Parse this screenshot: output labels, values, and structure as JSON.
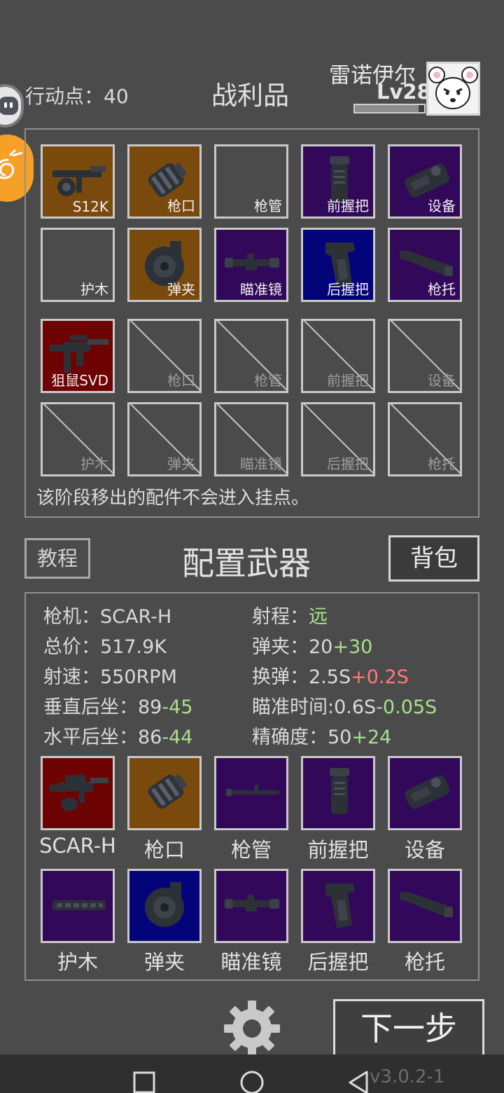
{
  "header": {
    "action_points": "行动点：40",
    "title": "战利品",
    "player_name": "雷诺伊尔",
    "player_level": "Lv28",
    "xp_progress": 0.92
  },
  "loot": {
    "rows": [
      [
        {
          "label": "S12K",
          "quality": "orange",
          "icon": "shotgun-icon"
        },
        {
          "label": "枪口",
          "quality": "orange",
          "icon": "muzzle-icon"
        },
        {
          "label": "枪管",
          "quality": "empty",
          "icon": ""
        },
        {
          "label": "前握把",
          "quality": "purple",
          "icon": "foregrip-icon"
        },
        {
          "label": "设备",
          "quality": "purple",
          "icon": "device-icon"
        }
      ],
      [
        {
          "label": "护木",
          "quality": "empty",
          "icon": ""
        },
        {
          "label": "弹夹",
          "quality": "orange",
          "icon": "drum-magazine-icon"
        },
        {
          "label": "瞄准镜",
          "quality": "purple",
          "icon": "scope-icon"
        },
        {
          "label": "后握把",
          "quality": "blue",
          "icon": "pistol-grip-icon"
        },
        {
          "label": "枪托",
          "quality": "purple",
          "icon": "stock-icon"
        }
      ],
      [
        {
          "label": "狙鼠SVD",
          "quality": "red",
          "icon": "sniper-rifle-icon"
        },
        {
          "label": "枪口",
          "quality": "disabled",
          "icon": ""
        },
        {
          "label": "枪管",
          "quality": "disabled",
          "icon": ""
        },
        {
          "label": "前握把",
          "quality": "disabled",
          "icon": ""
        },
        {
          "label": "设备",
          "quality": "disabled",
          "icon": ""
        }
      ],
      [
        {
          "label": "护木",
          "quality": "disabled",
          "icon": ""
        },
        {
          "label": "弹夹",
          "quality": "disabled",
          "icon": ""
        },
        {
          "label": "瞄准镜",
          "quality": "disabled",
          "icon": ""
        },
        {
          "label": "后握把",
          "quality": "disabled",
          "icon": ""
        },
        {
          "label": "枪托",
          "quality": "disabled",
          "icon": ""
        }
      ]
    ],
    "note": "该阶段移出的配件不会进入挂点。"
  },
  "config": {
    "tutorial_label": "教程",
    "title": "配置武器",
    "bag_label": "背包",
    "stats": {
      "receiver_label": "枪机：",
      "receiver_value": "SCAR-H",
      "range_label": "射程：",
      "range_value": "远",
      "price_label": "总价：",
      "price_value": "517.9K",
      "mag_label": "弹夹：",
      "mag_base": "20",
      "mag_delta": "+30",
      "rate_label": "射速：",
      "rate_value": "550RPM",
      "reload_label": "换弹：",
      "reload_base": "2.5S",
      "reload_delta": "+0.2S",
      "vrecoil_label": "垂直后坐：",
      "vrecoil_base": "89",
      "vrecoil_delta": "-45",
      "aim_label": "瞄准时间:",
      "aim_base": "0.6S",
      "aim_delta": "-0.05S",
      "hrecoil_label": "水平后坐：",
      "hrecoil_base": "86",
      "hrecoil_delta": "-44",
      "accuracy_label": "精确度：",
      "accuracy_base": "50",
      "accuracy_delta": "+24"
    },
    "slots": [
      [
        {
          "label": "SCAR-H",
          "quality": "red",
          "icon": "assault-rifle-icon"
        },
        {
          "label": "枪口",
          "quality": "orange",
          "icon": "muzzle-icon"
        },
        {
          "label": "枪管",
          "quality": "purple",
          "icon": "barrel-icon"
        },
        {
          "label": "前握把",
          "quality": "purple",
          "icon": "foregrip-icon"
        },
        {
          "label": "设备",
          "quality": "purple",
          "icon": "device-icon"
        }
      ],
      [
        {
          "label": "护木",
          "quality": "purple",
          "icon": "handguard-icon"
        },
        {
          "label": "弹夹",
          "quality": "blue",
          "icon": "drum-magazine-icon"
        },
        {
          "label": "瞄准镜",
          "quality": "purple",
          "icon": "scope-icon"
        },
        {
          "label": "后握把",
          "quality": "purple",
          "icon": "pistol-grip-icon"
        },
        {
          "label": "枪托",
          "quality": "purple",
          "icon": "stock-icon"
        }
      ]
    ]
  },
  "footer": {
    "next_label": "下一步",
    "version": "v3.0.2-1"
  }
}
